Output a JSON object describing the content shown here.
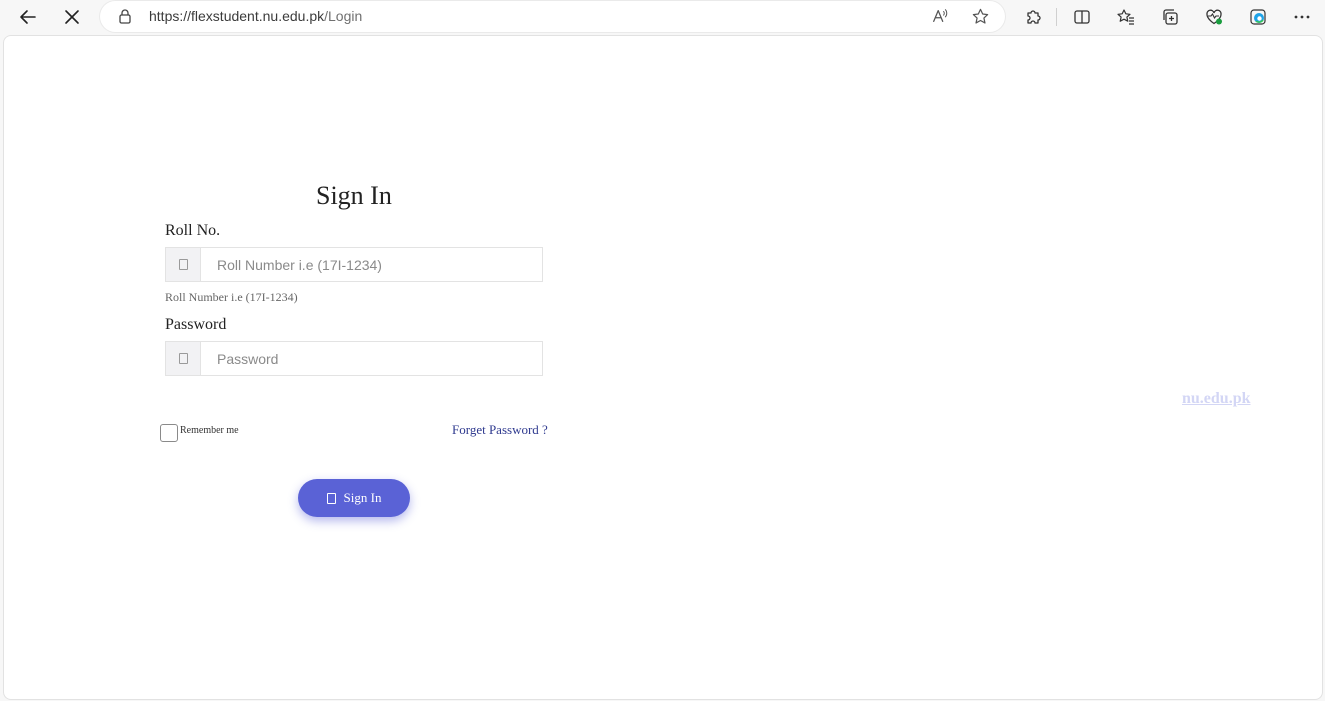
{
  "browser": {
    "url_host": "https://flexstudent.nu.edu.pk",
    "url_path": "/Login",
    "icons": {
      "back": "arrow-left-icon",
      "stop": "close-icon",
      "lock": "lock-icon",
      "read_aloud": "read-aloud-icon",
      "favorite": "star-icon",
      "extensions": "puzzle-icon",
      "split_screen": "split-screen-icon",
      "favorites": "favorites-icon",
      "collections": "collections-icon",
      "browser_essentials": "heart-pulse-icon",
      "edge_copilot": "edge-icon",
      "more": "more-icon"
    }
  },
  "login": {
    "title": "Sign In",
    "roll_label": "Roll No.",
    "roll_placeholder": "Roll Number i.e (17I-1234)",
    "roll_hint": "Roll Number i.e (17I-1234)",
    "password_label": "Password",
    "password_placeholder": "Password",
    "remember_label": "Remember me",
    "forget_label": "Forget Password ?",
    "signin_button": "Sign In"
  },
  "footer_link": "nu.edu.pk",
  "colors": {
    "button": "#5a62d6",
    "link": "#2f3a8f",
    "faded_link": "#d3d6f5"
  }
}
